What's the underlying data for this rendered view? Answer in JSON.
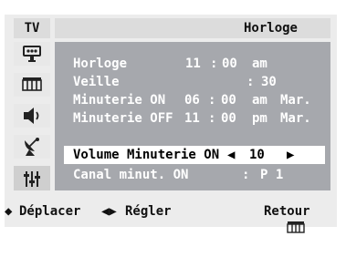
{
  "header": {
    "tv_label": "TV",
    "title": "Horloge"
  },
  "sidebar": {
    "icons": [
      "input-icon",
      "picture-icon",
      "sound-icon",
      "channel-antenna-icon",
      "setup-sliders-icon"
    ],
    "active_index": 4
  },
  "menu": {
    "rows": [
      {
        "label": "Horloge",
        "c1": "11",
        "sep": ":",
        "c2": "00",
        "c3": "am",
        "c4": ""
      },
      {
        "label": "Veille",
        "c1": "",
        "sep": ":",
        "c2": "30",
        "c3": "",
        "c4": ""
      },
      {
        "label": "Minuterie ON",
        "c1": "06",
        "sep": ":",
        "c2": "00",
        "c3": "am",
        "c4": "Mar."
      },
      {
        "label": "Minuterie OFF",
        "c1": "11",
        "sep": ":",
        "c2": "00",
        "c3": "pm",
        "c4": "Mar."
      },
      {
        "label": "Volume Minuterie ON",
        "value": "10",
        "selected": true
      },
      {
        "label": "Canal minut. ON",
        "sep": ":",
        "value": "P 1"
      }
    ]
  },
  "footer": {
    "move_label": "Déplacer",
    "adjust_label": "Régler",
    "return_label": "Retour"
  },
  "colors": {
    "panel": "#a6a8ad",
    "frame": "#ececec",
    "header": "#dcdcdc",
    "selected_row": "#ffffff",
    "text_on_panel": "#ffffff"
  }
}
